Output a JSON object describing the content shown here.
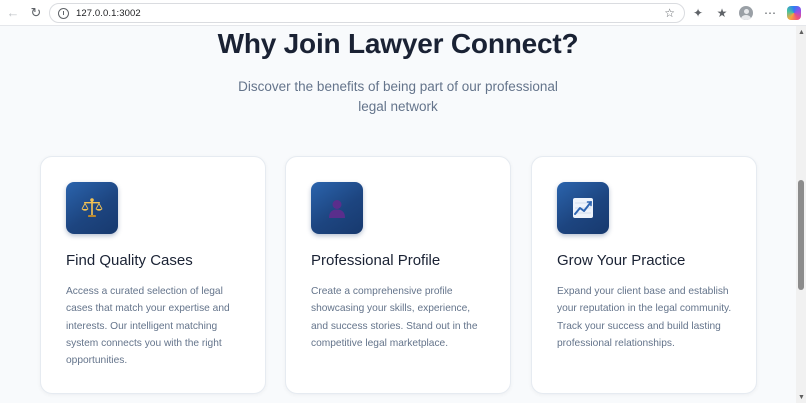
{
  "browser": {
    "url": "127.0.0.1:3002"
  },
  "section": {
    "heading": "Why Join Lawyer Connect?",
    "subtitle": "Discover the benefits of being part of our professional legal network"
  },
  "cards": [
    {
      "icon": "scales-of-justice-icon",
      "title": "Find Quality Cases",
      "text": "Access a curated selection of legal cases that match your expertise and interests. Our intelligent matching system connects you with the right opportunities."
    },
    {
      "icon": "user-profile-icon",
      "title": "Professional Profile",
      "text": "Create a comprehensive profile showcasing your skills, experience, and success stories. Stand out in the competitive legal marketplace."
    },
    {
      "icon": "growth-chart-icon",
      "title": "Grow Your Practice",
      "text": "Expand your client base and establish your reputation in the legal community. Track your success and build lasting professional relationships."
    }
  ],
  "colors": {
    "icon_gradient_start": "#2b64ad",
    "icon_gradient_end": "#17396e",
    "heading": "#1a2234",
    "body_text": "#64748b",
    "page_background": "#f8fafc"
  }
}
